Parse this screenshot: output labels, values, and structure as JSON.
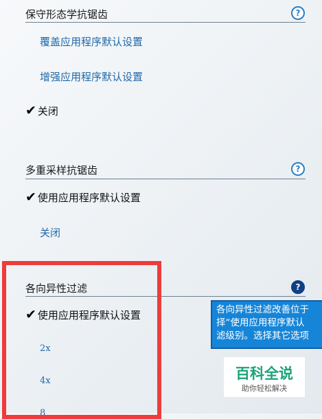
{
  "sections": [
    {
      "title": "保守形态学抗锯齿",
      "options": [
        {
          "label": "覆盖应用程序默认设置",
          "selected": false
        },
        {
          "label": "增强应用程序默认设置",
          "selected": false
        },
        {
          "label": "关闭",
          "selected": true
        }
      ]
    },
    {
      "title": "多重采样抗锯齿",
      "options": [
        {
          "label": "使用应用程序默认设置",
          "selected": true
        },
        {
          "label": "关闭",
          "selected": false
        }
      ]
    },
    {
      "title": "各向异性过滤",
      "options": [
        {
          "label": "使用应用程序默认设置",
          "selected": true
        },
        {
          "label": "2x",
          "selected": false
        },
        {
          "label": "4x",
          "selected": false
        },
        {
          "label": "8",
          "selected": false
        }
      ]
    }
  ],
  "help_glyph": "?",
  "check_glyph": "✔",
  "tooltip": {
    "lines": [
      "各向异性过滤改善位于",
      "择“使用应用程序默认",
      "滤级别。选择其它选项"
    ]
  },
  "watermark": {
    "title": "百科全说",
    "subtitle": "助你轻松解决"
  },
  "colors": {
    "link": "#1f68a8",
    "highlight": "#ef3b3b",
    "tooltip_bg": "#1685d8",
    "help_active": "#0f3f86",
    "watermark": "#19a47a"
  }
}
